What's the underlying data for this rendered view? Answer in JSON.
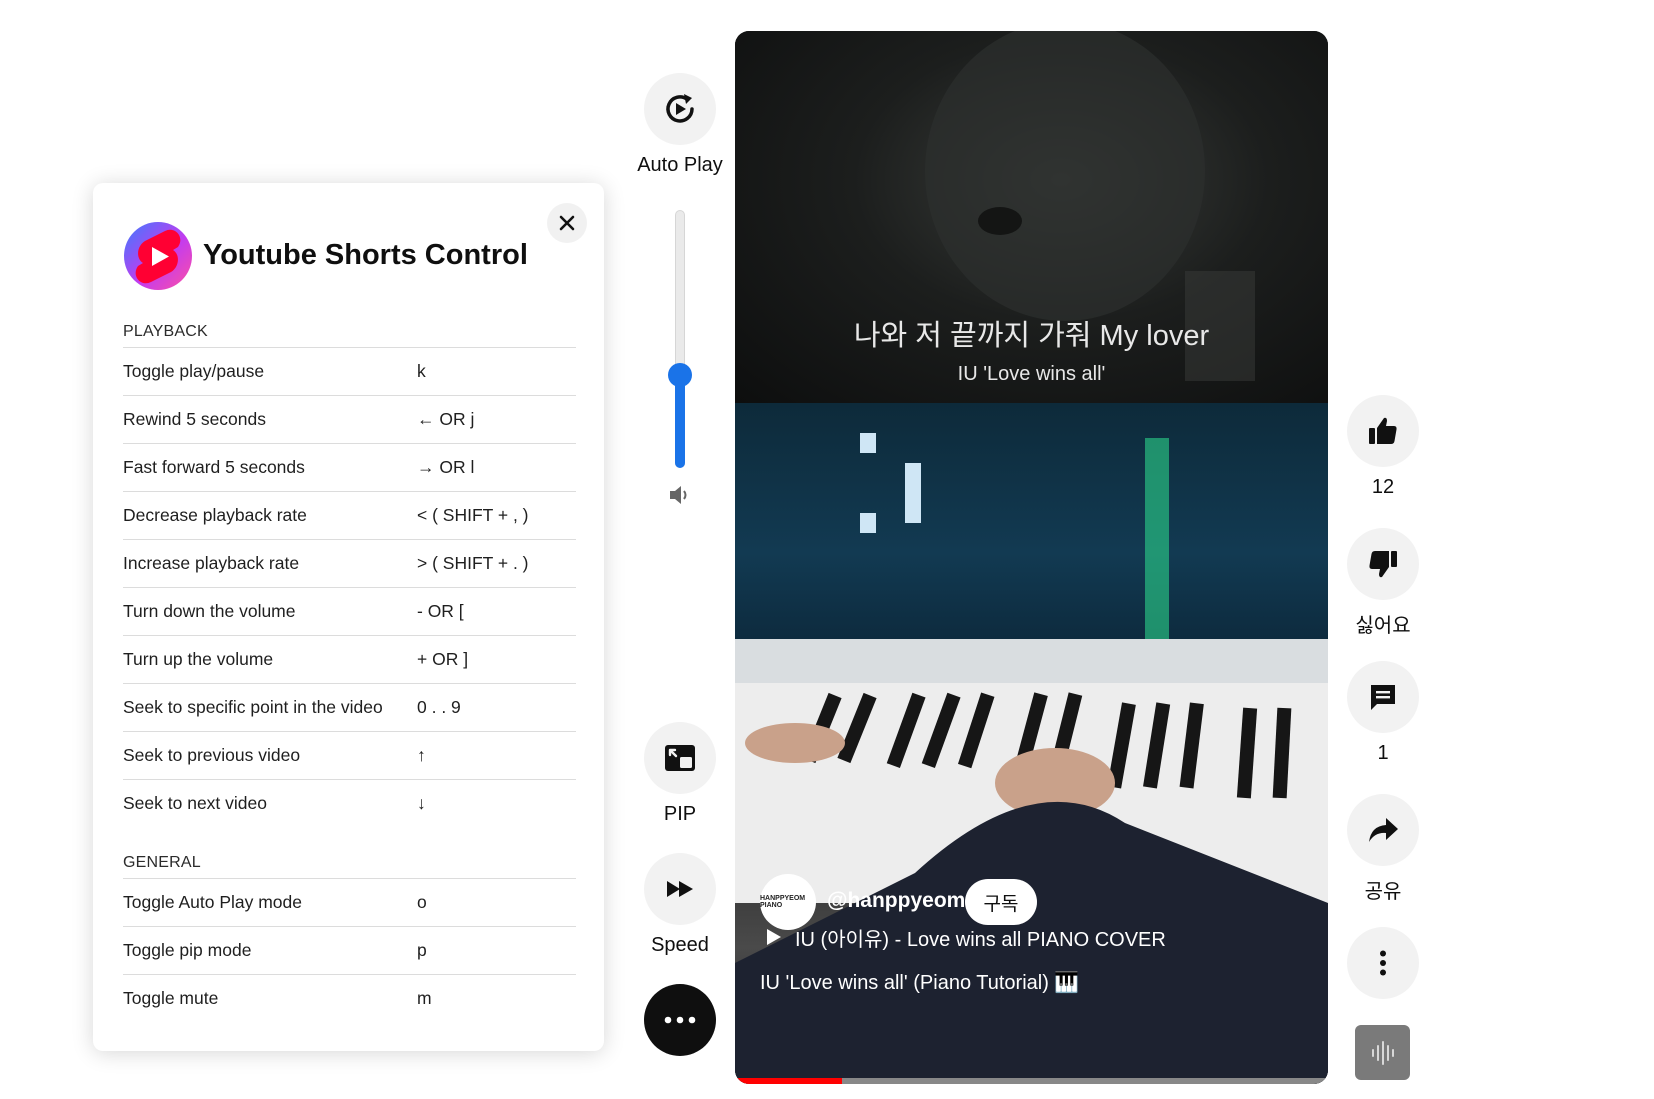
{
  "panel": {
    "title": "Youtube Shorts Control",
    "sections": [
      {
        "title": "PLAYBACK",
        "rows": [
          {
            "desc": "Toggle play/pause",
            "key": "k"
          },
          {
            "desc": "Rewind 5 seconds",
            "key": "← OR j"
          },
          {
            "desc": "Fast forward 5 seconds",
            "key": "→ OR l"
          },
          {
            "desc": "Decrease playback rate",
            "key": "< ( SHIFT + , )"
          },
          {
            "desc": "Increase playback rate",
            "key": "> ( SHIFT + . )"
          },
          {
            "desc": "Turn down the volume",
            "key": "- OR ["
          },
          {
            "desc": "Turn up the volume",
            "key": "+ OR ]"
          },
          {
            "desc": "Seek to specific point in the video",
            "key": "0 . . 9"
          },
          {
            "desc": "Seek to previous video",
            "key": "↑"
          },
          {
            "desc": "Seek to next video",
            "key": "↓"
          }
        ]
      },
      {
        "title": "GENERAL",
        "rows": [
          {
            "desc": "Toggle Auto Play mode",
            "key": "o"
          },
          {
            "desc": "Toggle pip mode",
            "key": "p"
          },
          {
            "desc": "Toggle mute",
            "key": "m"
          }
        ]
      }
    ]
  },
  "controls": {
    "autoplay_label": "Auto Play",
    "pip_label": "PIP",
    "speed_label": "Speed",
    "volume_level": 0.36
  },
  "video": {
    "lyric_line": "나와 저 끝까지 가줘 My lover",
    "lyric_sub": "IU 'Love wins all'",
    "channel_handle": "@hanppyeom",
    "avatar_text": "HANPPYEOM PIANO",
    "subscribe_label": "구독",
    "playlist_title": "IU (아이유) - Love wins all PIANO COVER",
    "video_title": "IU 'Love wins all' (Piano Tutorial) 🎹",
    "progress": 0.18
  },
  "actions": {
    "like_count": "12",
    "dislike_label": "싫어요",
    "comment_count": "1",
    "share_label": "공유"
  },
  "colors": {
    "accent": "#1a73e8",
    "progress": "#ff0000",
    "shorts_red": "#ff0033",
    "shorts_pink": "#e040fb",
    "shorts_blue": "#3d7bff"
  }
}
